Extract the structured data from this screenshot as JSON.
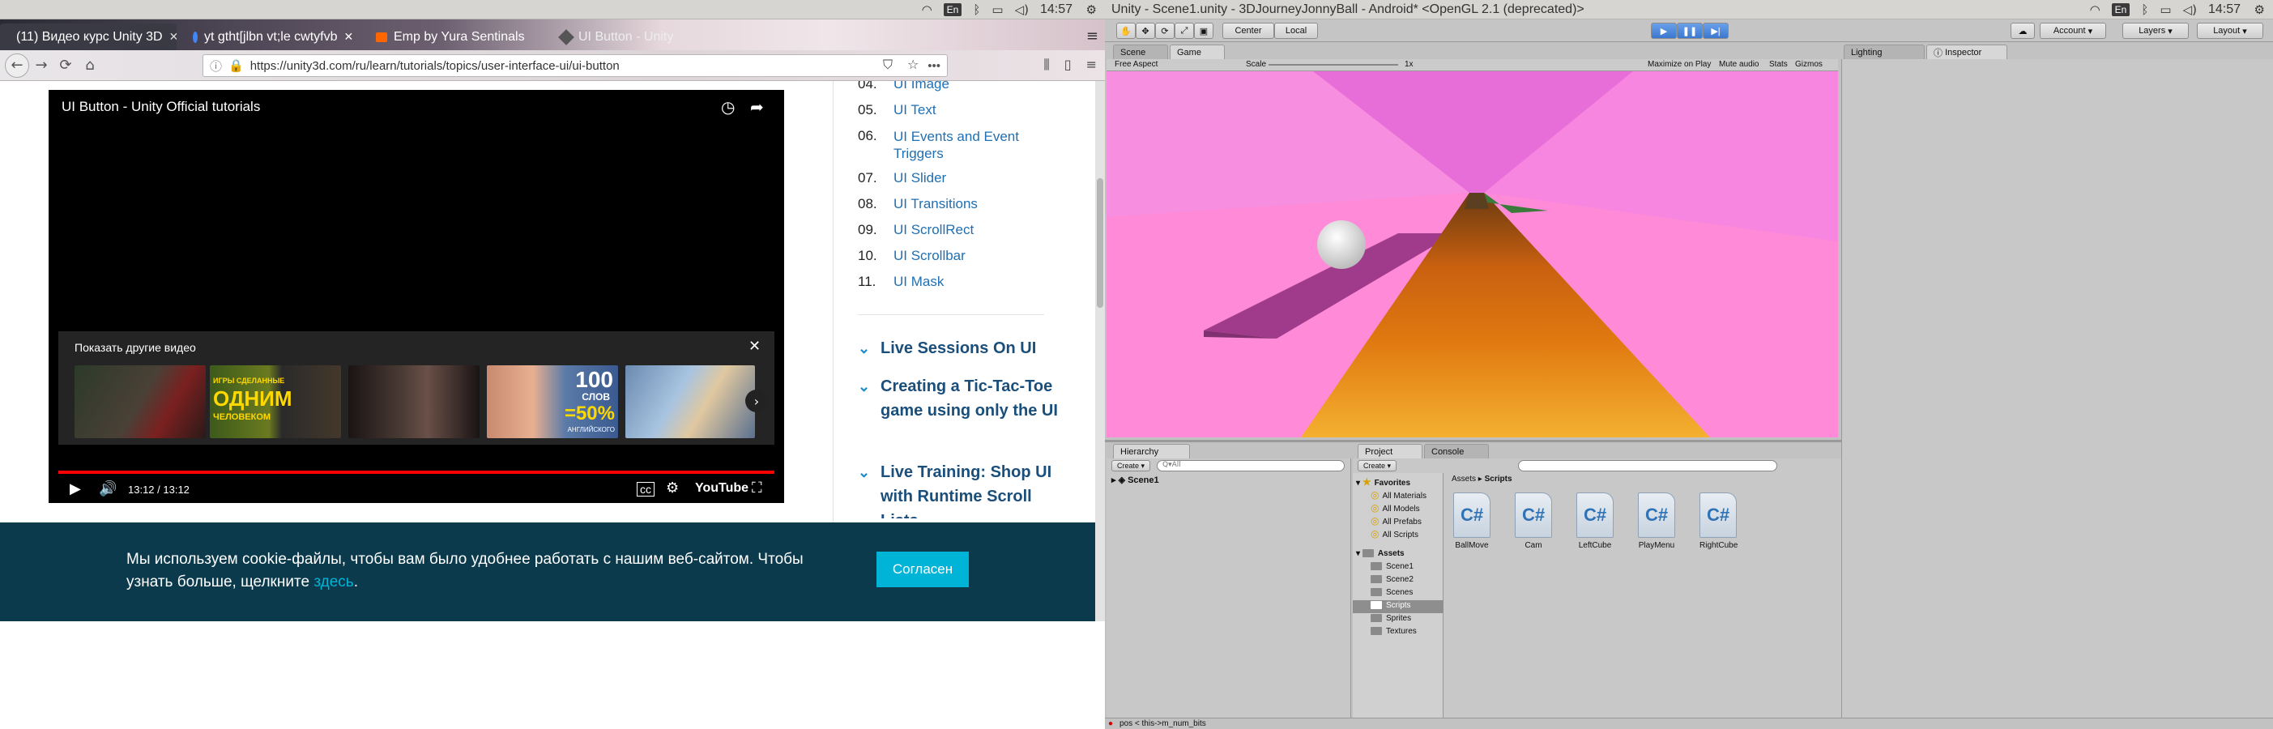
{
  "system_left": {
    "time": "14:57",
    "lang": "En"
  },
  "system_right": {
    "time": "14:57",
    "lang": "En"
  },
  "unity_title": "Unity - Scene1.unity - 3DJourneyJonnyBall - Android* <OpenGL 2.1 (deprecated)>",
  "browser": {
    "tabs": [
      {
        "label": "(11) Видео курс Unity 3D",
        "color": "#3a3a44",
        "text": "#ffffff"
      },
      {
        "label": "yt gtht[jlbn vt;le cwtyfvb",
        "color": "transparent",
        "text": "#ffffff"
      },
      {
        "label": "Emp by Yura Sentinals",
        "color": "transparent",
        "text": "#ffffff"
      },
      {
        "label": "UI Button - Unity",
        "color": "transparent",
        "text": "#eeeeee"
      }
    ],
    "url": "https://unity3d.com/ru/learn/tutorials/topics/user-interface-ui/ui-button"
  },
  "video": {
    "title": "UI Button - Unity Official tutorials",
    "more_videos": "Показать другие видео",
    "time": "13:12 / 13:12",
    "youtube": "YouTube",
    "thumb_text_1": "ИГРЫ СДЕЛАННЫЕ",
    "thumb_text_2": "ОДНИМ",
    "thumb_text_3": "ЧЕЛОВЕКОМ",
    "thumb_num_1": "100",
    "thumb_num_2": "СЛОВ",
    "thumb_num_3": "=50%",
    "thumb_num_4": "АНГЛИЙСКОГО"
  },
  "toc": [
    {
      "num": "04.",
      "title": "UI Image"
    },
    {
      "num": "05.",
      "title": "UI Text"
    },
    {
      "num": "06.",
      "title": "UI Events and Event Triggers"
    },
    {
      "num": "07.",
      "title": "UI Slider"
    },
    {
      "num": "08.",
      "title": "UI Transitions"
    },
    {
      "num": "09.",
      "title": "UI ScrollRect"
    },
    {
      "num": "10.",
      "title": "UI Scrollbar"
    },
    {
      "num": "11.",
      "title": "UI Mask"
    }
  ],
  "sections": [
    {
      "title": "Live Sessions On UI"
    },
    {
      "title": "Creating a Tic-Tac-Toe game using only the UI"
    },
    {
      "title": "Live Training: Shop UI with Runtime Scroll Lists"
    }
  ],
  "cookie": {
    "text_1": "Мы используем cookie-файлы, чтобы вам было удобнее работать с нашим веб-сайтом. Чтобы",
    "text_2": "узнать больше, щелкните",
    "link": "здесь",
    "dot": ".",
    "button": "Согласен"
  },
  "unity": {
    "toolbar": {
      "center": "Center",
      "local": "Local",
      "account": "Account",
      "layers": "Layers",
      "layout": "Layout"
    },
    "scene_tab": "Scene",
    "game_tab": "Game",
    "aspect": "Free Aspect",
    "scale_label": "Scale",
    "scale_value": "1x",
    "maximize": "Maximize on Play",
    "mute": "Mute audio",
    "stats": "Stats",
    "gizmos": "Gizmos",
    "lighting_tab": "Lighting",
    "inspector_tab": "Inspector",
    "hierarchy_tab": "Hierarchy",
    "create": "Create",
    "search_all": "Q▾All",
    "scene1": "Scene1",
    "project_tab": "Project",
    "console_tab": "Console",
    "favorites": "Favorites",
    "fav_items": [
      "All Materials",
      "All Models",
      "All Prefabs",
      "All Scripts"
    ],
    "assets": "Assets",
    "asset_folders": [
      "Scene1",
      "Scene2",
      "Scenes",
      "Scripts",
      "Sprites",
      "Textures"
    ],
    "breadcrumb_assets": "Assets",
    "breadcrumb_sep": "▸",
    "breadcrumb_scripts": "Scripts",
    "scripts": [
      "BallMove",
      "Cam",
      "LeftCube",
      "PlayMenu",
      "RightCube"
    ],
    "cs_label": "C#",
    "status": "pos < this->m_num_bits"
  }
}
